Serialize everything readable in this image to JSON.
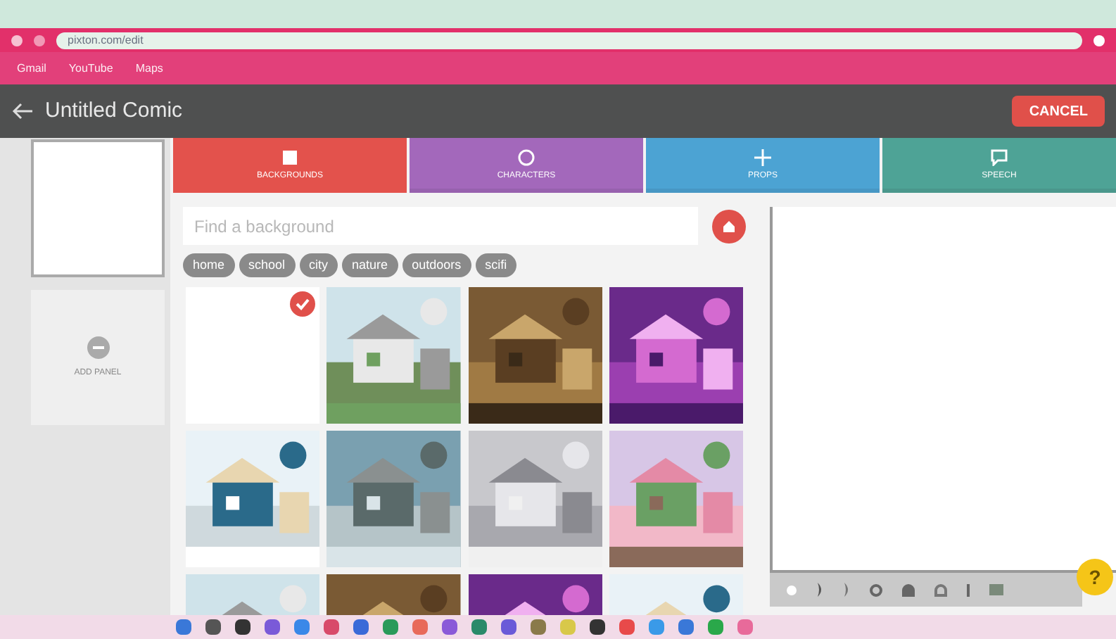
{
  "browser": {
    "address": "pixton.com/edit",
    "bookmarks": [
      "Gmail",
      "YouTube",
      "Maps"
    ]
  },
  "header": {
    "title": "Untitled Comic",
    "cancel": "CANCEL"
  },
  "panels": [
    {
      "kind": "panel",
      "selected": true
    },
    {
      "kind": "add",
      "label": "ADD PANEL"
    }
  ],
  "tabs": [
    {
      "label": "BACKGROUNDS",
      "color": "#e3524c",
      "selected": true
    },
    {
      "label": "CHARACTERS",
      "color": "#9b59b6",
      "selected": false
    },
    {
      "label": "PROPS",
      "color": "#3a9bd0",
      "selected": false
    },
    {
      "label": "SPEECH",
      "color": "#3d9b8c",
      "selected": false
    }
  ],
  "search": {
    "placeholder": "Find a background"
  },
  "tags": [
    "home",
    "school",
    "city",
    "nature",
    "outdoors",
    "scifi"
  ],
  "backgrounds": [
    {
      "kind": "blank",
      "selected": true
    },
    {
      "kind": "picture",
      "selected": false
    },
    {
      "kind": "picture",
      "selected": false
    },
    {
      "kind": "picture",
      "selected": false
    },
    {
      "kind": "picture",
      "selected": false
    },
    {
      "kind": "picture",
      "selected": false
    },
    {
      "kind": "picture",
      "selected": false
    },
    {
      "kind": "picture",
      "selected": false
    },
    {
      "kind": "picture",
      "selected": false
    },
    {
      "kind": "picture",
      "selected": false
    },
    {
      "kind": "picture",
      "selected": false
    },
    {
      "kind": "picture",
      "selected": false
    }
  ],
  "help": "?"
}
